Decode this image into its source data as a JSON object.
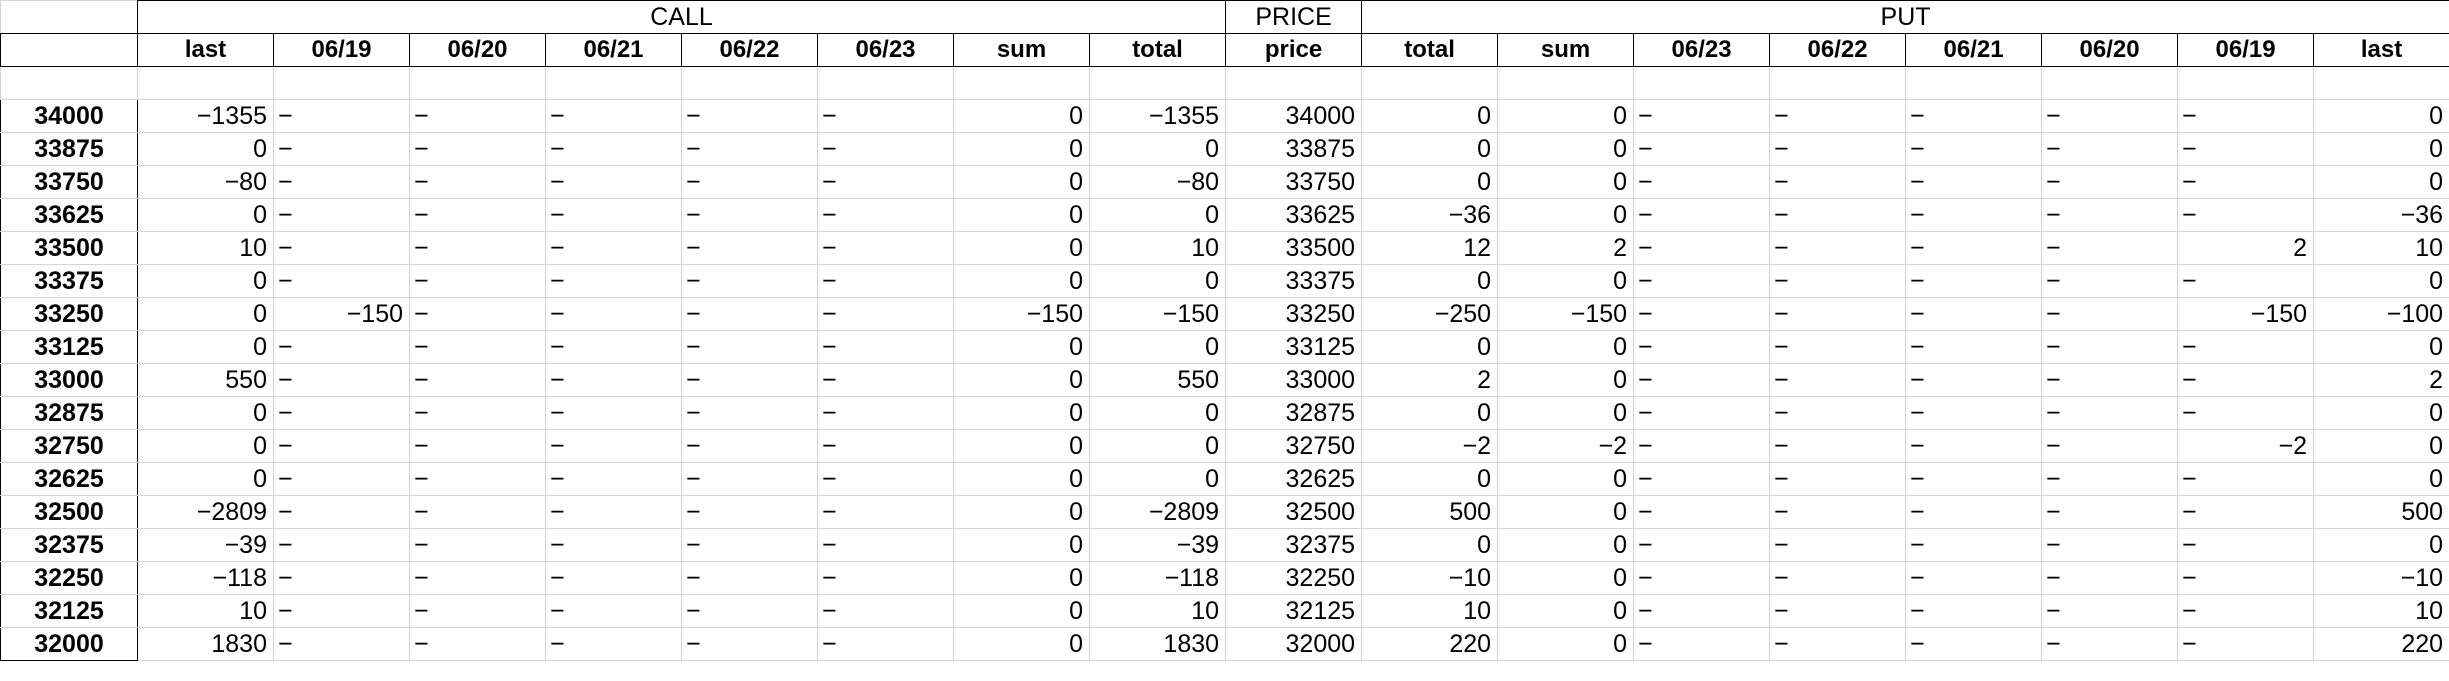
{
  "groups": {
    "call": "CALL",
    "price": "PRICE",
    "put": "PUT"
  },
  "columns": [
    "last",
    "06/19",
    "06/20",
    "06/21",
    "06/22",
    "06/23",
    "sum",
    "total",
    "price",
    "total",
    "sum",
    "06/23",
    "06/22",
    "06/21",
    "06/20",
    "06/19",
    "last"
  ],
  "rows": [
    [
      "34000",
      "−1355",
      "−",
      "−",
      "−",
      "−",
      "−",
      "0",
      "−1355",
      "34000",
      "0",
      "0",
      "−",
      "−",
      "−",
      "−",
      "−",
      "0"
    ],
    [
      "33875",
      "0",
      "−",
      "−",
      "−",
      "−",
      "−",
      "0",
      "0",
      "33875",
      "0",
      "0",
      "−",
      "−",
      "−",
      "−",
      "−",
      "0"
    ],
    [
      "33750",
      "−80",
      "−",
      "−",
      "−",
      "−",
      "−",
      "0",
      "−80",
      "33750",
      "0",
      "0",
      "−",
      "−",
      "−",
      "−",
      "−",
      "0"
    ],
    [
      "33625",
      "0",
      "−",
      "−",
      "−",
      "−",
      "−",
      "0",
      "0",
      "33625",
      "−36",
      "0",
      "−",
      "−",
      "−",
      "−",
      "−",
      "−36"
    ],
    [
      "33500",
      "10",
      "−",
      "−",
      "−",
      "−",
      "−",
      "0",
      "10",
      "33500",
      "12",
      "2",
      "−",
      "−",
      "−",
      "−",
      "2",
      "10"
    ],
    [
      "33375",
      "0",
      "−",
      "−",
      "−",
      "−",
      "−",
      "0",
      "0",
      "33375",
      "0",
      "0",
      "−",
      "−",
      "−",
      "−",
      "−",
      "0"
    ],
    [
      "33250",
      "0",
      "−150",
      "−",
      "−",
      "−",
      "−",
      "−150",
      "−150",
      "33250",
      "−250",
      "−150",
      "−",
      "−",
      "−",
      "−",
      "−150",
      "−100"
    ],
    [
      "33125",
      "0",
      "−",
      "−",
      "−",
      "−",
      "−",
      "0",
      "0",
      "33125",
      "0",
      "0",
      "−",
      "−",
      "−",
      "−",
      "−",
      "0"
    ],
    [
      "33000",
      "550",
      "−",
      "−",
      "−",
      "−",
      "−",
      "0",
      "550",
      "33000",
      "2",
      "0",
      "−",
      "−",
      "−",
      "−",
      "−",
      "2"
    ],
    [
      "32875",
      "0",
      "−",
      "−",
      "−",
      "−",
      "−",
      "0",
      "0",
      "32875",
      "0",
      "0",
      "−",
      "−",
      "−",
      "−",
      "−",
      "0"
    ],
    [
      "32750",
      "0",
      "−",
      "−",
      "−",
      "−",
      "−",
      "0",
      "0",
      "32750",
      "−2",
      "−2",
      "−",
      "−",
      "−",
      "−",
      "−2",
      "0"
    ],
    [
      "32625",
      "0",
      "−",
      "−",
      "−",
      "−",
      "−",
      "0",
      "0",
      "32625",
      "0",
      "0",
      "−",
      "−",
      "−",
      "−",
      "−",
      "0"
    ],
    [
      "32500",
      "−2809",
      "−",
      "−",
      "−",
      "−",
      "−",
      "0",
      "−2809",
      "32500",
      "500",
      "0",
      "−",
      "−",
      "−",
      "−",
      "−",
      "500"
    ],
    [
      "32375",
      "−39",
      "−",
      "−",
      "−",
      "−",
      "−",
      "0",
      "−39",
      "32375",
      "0",
      "0",
      "−",
      "−",
      "−",
      "−",
      "−",
      "0"
    ],
    [
      "32250",
      "−118",
      "−",
      "−",
      "−",
      "−",
      "−",
      "0",
      "−118",
      "32250",
      "−10",
      "0",
      "−",
      "−",
      "−",
      "−",
      "−",
      "−10"
    ],
    [
      "32125",
      "10",
      "−",
      "−",
      "−",
      "−",
      "−",
      "0",
      "10",
      "32125",
      "10",
      "0",
      "−",
      "−",
      "−",
      "−",
      "−",
      "10"
    ],
    [
      "32000",
      "1830",
      "−",
      "−",
      "−",
      "−",
      "−",
      "0",
      "1830",
      "32000",
      "220",
      "0",
      "−",
      "−",
      "−",
      "−",
      "−",
      "220"
    ]
  ]
}
